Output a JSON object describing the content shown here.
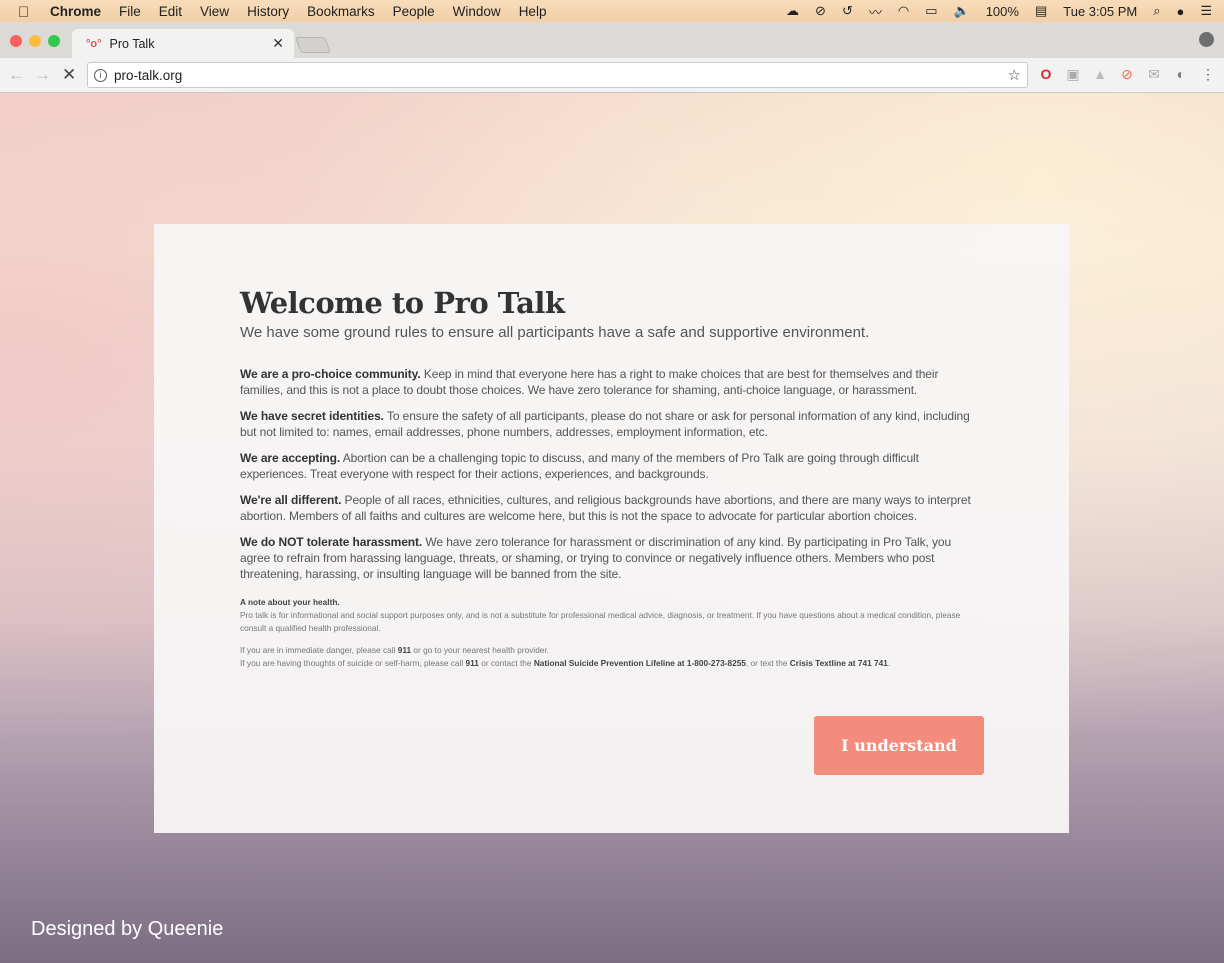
{
  "menubar": {
    "app": "Chrome",
    "items": [
      "File",
      "Edit",
      "View",
      "History",
      "Bookmarks",
      "People",
      "Window",
      "Help"
    ],
    "battery": "100%",
    "clock": "Tue 3:05 PM"
  },
  "browser": {
    "tab_title": "Pro Talk",
    "url": "pro-talk.org"
  },
  "modal": {
    "title": "Welcome to Pro Talk",
    "subtitle": "We have some ground rules to ensure all participants have a safe and supportive environment.",
    "rules": [
      {
        "lead": "We are a pro-choice community.",
        "body": " Keep in mind that everyone here has a right to make choices that are best for themselves and their families, and this is not a place to doubt those choices. We have zero tolerance for shaming, anti-choice language, or harassment."
      },
      {
        "lead": "We have secret identities.",
        "body": " To ensure the safety of all participants, please do not share or ask for personal information of any kind, including but not limited to: names, email addresses, phone numbers, addresses, employment information, etc."
      },
      {
        "lead": "We are accepting.",
        "body": " Abortion can be a challenging topic to discuss, and many of the members of Pro Talk are going through difficult experiences. Treat everyone with respect for their actions, experiences, and backgrounds."
      },
      {
        "lead": "We're all different.",
        "body": " People of all races, ethnicities, cultures, and religious backgrounds have abortions, and there are many ways to interpret abortion. Members of all faiths and cultures are welcome here, but this is not the space to advocate for particular abortion choices."
      },
      {
        "lead": "We do NOT tolerate harassment.",
        "body": " We have zero tolerance for harassment or discrimination of any kind. By participating in Pro Talk, you agree to refrain from harassing language, threats, or shaming, or trying to convince or negatively influence others. Members who post threatening, harassing, or insulting language will be banned from the site."
      }
    ],
    "health": {
      "heading": "A note about your health.",
      "disclaimer": "Pro talk is for informational and social support purposes only, and is not a substitute for professional medical advice, diagnosis, or treatment. If you have questions about a medical condition, please consult a qualified health professional.",
      "danger": [
        "If you are in immediate danger, please call ",
        "911",
        " or go to your nearest health provider."
      ],
      "suicide": [
        "If you are having thoughts of suicide or self-harm, please call ",
        "911",
        " or contact the ",
        "National Suicide Prevention Lifeline at 1-800-273-8255",
        ", or text the ",
        "Crisis Textline at 741 741",
        "."
      ]
    },
    "button": "I understand"
  },
  "credit": "Designed by Queenie",
  "colors": {
    "accent": "#f38c7c"
  }
}
